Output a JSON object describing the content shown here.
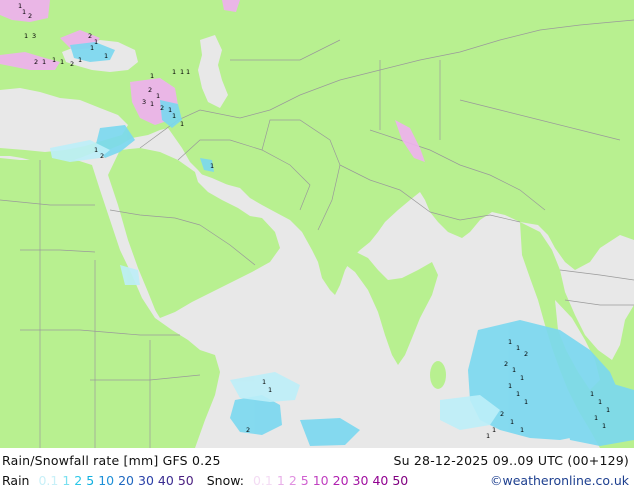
{
  "footer": {
    "title": "Rain/Snowfall rate [mm] GFS 0.25",
    "datetime": "Su 28-12-2025 09..09 UTC (00+129)",
    "rain_label": "Rain",
    "rain_scale": [
      {
        "v": "0.1",
        "c": "#c8f0f8"
      },
      {
        "v": "1",
        "c": "#7ae0f0"
      },
      {
        "v": "2",
        "c": "#2cc8e8"
      },
      {
        "v": "5",
        "c": "#10b0e0"
      },
      {
        "v": "10",
        "c": "#1e90d8"
      },
      {
        "v": "20",
        "c": "#1f68c0"
      },
      {
        "v": "30",
        "c": "#2a40a8"
      },
      {
        "v": "40",
        "c": "#3a2c90"
      },
      {
        "v": "50",
        "c": "#4a1f80"
      }
    ],
    "snow_label": "Snow:",
    "snow_scale": [
      {
        "v": "0.1",
        "c": "#f4dcf4"
      },
      {
        "v": "1",
        "c": "#e8b0e8"
      },
      {
        "v": "2",
        "c": "#e090e0"
      },
      {
        "v": "5",
        "c": "#d060d0"
      },
      {
        "v": "10",
        "c": "#c040c0"
      },
      {
        "v": "20",
        "c": "#b020b0"
      },
      {
        "v": "30",
        "c": "#a010a0"
      },
      {
        "v": "40",
        "c": "#900090"
      },
      {
        "v": "50",
        "c": "#800080"
      }
    ],
    "credit": "©weatheronline.co.uk"
  },
  "map": {
    "land_color": "#b8f090",
    "sea_color": "#e8e8e8",
    "border_color": "#9a9a9a",
    "rain_light_color": "#bdeef8",
    "rain_color": "#7ad8f0",
    "snow_color": "#f0b0f0",
    "marker_values": [
      "1",
      "1",
      "2",
      "1",
      "3",
      "2",
      "1",
      "1",
      "1",
      "2",
      "1",
      "1",
      "1",
      "2",
      "1",
      "1",
      "1",
      "1",
      "1",
      "2",
      "1",
      "3",
      "1",
      "2",
      "1",
      "1",
      "1",
      "1",
      "2",
      "1",
      "1",
      "1",
      "2",
      "2",
      "1",
      "1",
      "1",
      "1",
      "1",
      "2",
      "1",
      "1",
      "1",
      "1",
      "1",
      "1",
      "1",
      "1",
      "1",
      "1",
      "1",
      "2"
    ]
  }
}
